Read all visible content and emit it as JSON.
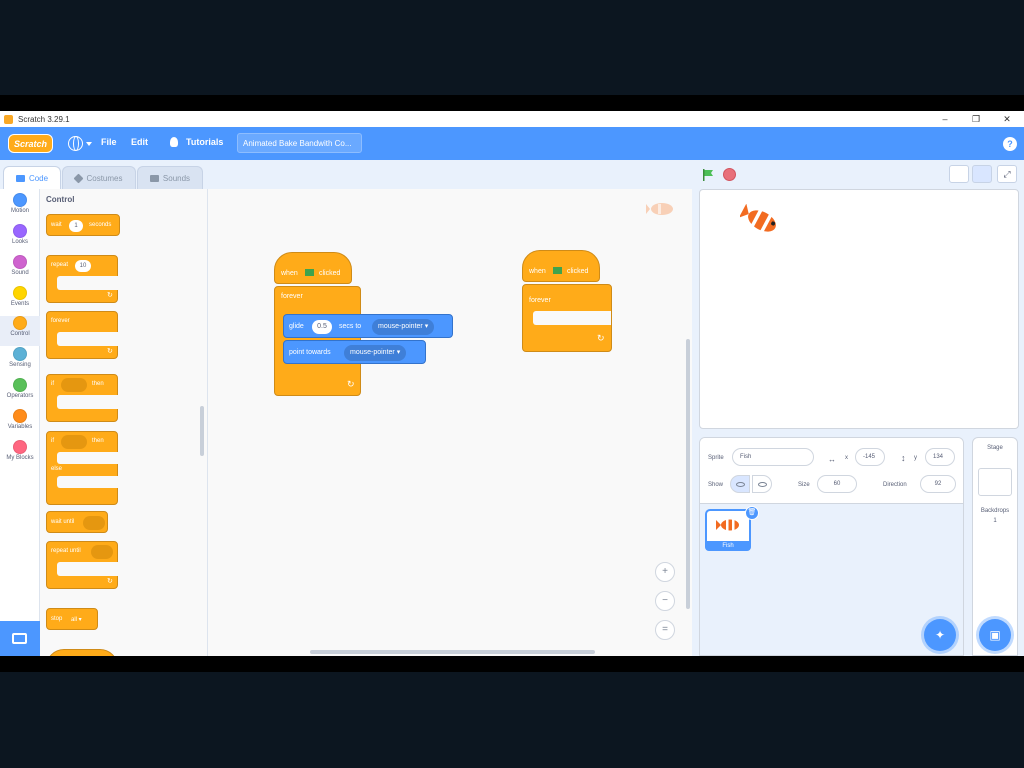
{
  "window": {
    "title": "Scratch 3.29.1",
    "min": "–",
    "restore": "❐",
    "close": "✕"
  },
  "menubar": {
    "logo": "Scratch",
    "file": "File",
    "edit": "Edit",
    "tutorials": "Tutorials",
    "project_title": "Animated Bake Bandwith Co...",
    "help": "?"
  },
  "tabs": {
    "code": "Code",
    "costumes": "Costumes",
    "sounds": "Sounds"
  },
  "categories": [
    {
      "label": "Motion",
      "color": "#4c97ff"
    },
    {
      "label": "Looks",
      "color": "#9966ff"
    },
    {
      "label": "Sound",
      "color": "#cf63cf"
    },
    {
      "label": "Events",
      "color": "#ffd500"
    },
    {
      "label": "Control",
      "color": "#ffab19"
    },
    {
      "label": "Sensing",
      "color": "#5cb1d6"
    },
    {
      "label": "Operators",
      "color": "#59c059"
    },
    {
      "label": "Variables",
      "color": "#ff8c1a"
    },
    {
      "label": "My Blocks",
      "color": "#ff6680"
    }
  ],
  "palette": {
    "heading": "Control",
    "wait": "wait",
    "wait_value": "1",
    "seconds": "seconds",
    "repeat": "repeat",
    "repeat_value": "10",
    "forever": "forever",
    "if": "if",
    "then": "then",
    "if2": "if",
    "then2": "then",
    "else": "else",
    "wait_until": "wait until",
    "repeat_until": "repeat until",
    "stop": "stop",
    "stop_value": "all ▾"
  },
  "workspace": {
    "script1": {
      "hat": "when",
      "clicked": "clicked",
      "forever": "forever",
      "glide": "glide",
      "glide_secs": "0.5",
      "secs_to": "secs to",
      "target": "mouse-pointer ▾",
      "point": "point towards",
      "point_target": "mouse-pointer ▾"
    },
    "script2": {
      "hat": "when",
      "clicked": "clicked",
      "forever": "forever"
    },
    "zoom_in": "+",
    "zoom_out": "−",
    "zoom_reset": "="
  },
  "sprite": {
    "sprite_label": "Sprite",
    "name": "Fish",
    "x_label": "x",
    "x_value": "-145",
    "y_label": "y",
    "y_value": "134",
    "show_label": "Show",
    "size_label": "Size",
    "size_value": "60",
    "direction_label": "Direction",
    "direction_value": "92",
    "thumb_name": "Fish"
  },
  "stage_pane": {
    "heading": "Stage",
    "backdrops_label": "Backdrops",
    "backdrops_count": "1"
  },
  "colors": {
    "accent": "#4c97ff",
    "control": "#ffab19",
    "motion": "#4c97ff"
  }
}
